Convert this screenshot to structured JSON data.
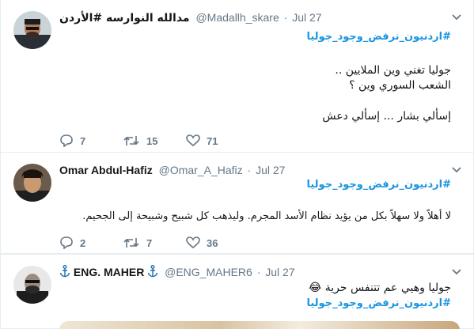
{
  "tweets": [
    {
      "name": "مدالله النوارسه #الأردن",
      "handle": "@Madallh_skare",
      "time": "Jul 27",
      "hashtag": "#اردنيون_نرفض_وجود_جوليا",
      "lines": [
        "جوليا تغني وين الملايين ..",
        "الشعب السوري وين ؟",
        "",
        "إسألي بشار ... إسألي دعش"
      ],
      "replies": "7",
      "retweets": "15",
      "likes": "71"
    },
    {
      "name": "Omar Abdul-Hafiz",
      "handle": "@Omar_A_Hafiz",
      "time": "Jul 27",
      "hashtag": "#اردنيون_نرفض_وجود_جوليا",
      "lines": [
        "لا أهلاً ولا سهلاً بكل من يؤيد نظام الأسد المجرم. وليذهب كل شبيح وشبيحة إلى الجحيم."
      ],
      "replies": "2",
      "retweets": "7",
      "likes": "36"
    },
    {
      "name": "ENG. MAHER",
      "handle": "@ENG_MAHER6",
      "time": "Jul 27",
      "text": "جوليا وهيي عم تتنفس حرية 😂",
      "hashtag": "#اردنيون_نرفض_وجود_جوليا"
    }
  ],
  "separator": "·",
  "icons": {
    "reply": "reply-icon",
    "retweet": "retweet-icon",
    "like": "heart-icon",
    "caret": "chevron-down-icon",
    "anchor": "anchor-icon"
  },
  "colors": {
    "link": "#1b95e0",
    "muted": "#657786",
    "text": "#14171a"
  }
}
